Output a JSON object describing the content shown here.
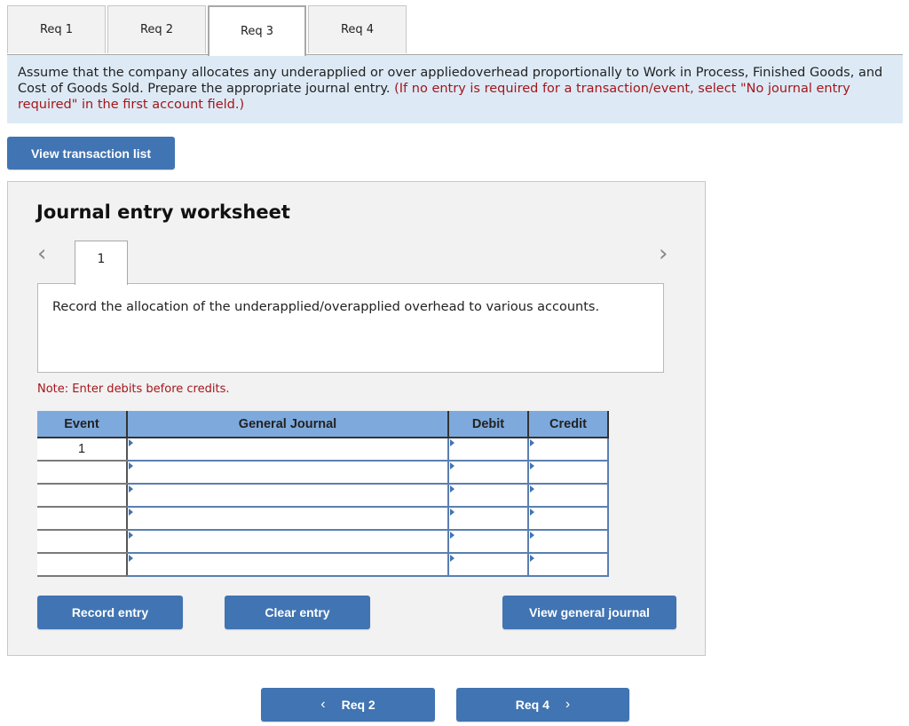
{
  "tabs": [
    {
      "label": "Req 1",
      "active": false
    },
    {
      "label": "Req 2",
      "active": false
    },
    {
      "label": "Req 3",
      "active": true
    },
    {
      "label": "Req 4",
      "active": false
    }
  ],
  "instructions": {
    "text": "Assume that the company allocates any underapplied or over appliedoverhead proportionally to Work in Process, Finished Goods, and Cost of Goods Sold. Prepare the appropriate journal entry. ",
    "note_red": "(If no entry is required for a transaction/event, select \"No journal entry required\" in the first account field.)"
  },
  "buttons": {
    "view_transaction_list": "View transaction list",
    "record_entry": "Record entry",
    "clear_entry": "Clear entry",
    "view_general_journal": "View general journal"
  },
  "worksheet": {
    "title": "Journal entry worksheet",
    "prev_icon": "chevron-left-icon",
    "next_icon": "chevron-right-icon",
    "entry_tab": "1",
    "description": "Record the allocation of the underapplied/overapplied overhead to various accounts.",
    "note": "Note: Enter debits before credits.",
    "columns": [
      "Event",
      "General Journal",
      "Debit",
      "Credit"
    ],
    "rows": [
      {
        "event": "1",
        "account": "",
        "debit": "",
        "credit": ""
      },
      {
        "event": "",
        "account": "",
        "debit": "",
        "credit": ""
      },
      {
        "event": "",
        "account": "",
        "debit": "",
        "credit": ""
      },
      {
        "event": "",
        "account": "",
        "debit": "",
        "credit": ""
      },
      {
        "event": "",
        "account": "",
        "debit": "",
        "credit": ""
      },
      {
        "event": "",
        "account": "",
        "debit": "",
        "credit": ""
      }
    ]
  },
  "navigation": {
    "prev_label": "Req 2",
    "prev_icon": "‹",
    "next_label": "Req 4",
    "next_icon": "›"
  },
  "colors": {
    "accent_button": "#4174b2",
    "instruction_bg": "#ddeaf6",
    "warning_text": "#a4161a",
    "table_header": "#7ea9dc"
  }
}
